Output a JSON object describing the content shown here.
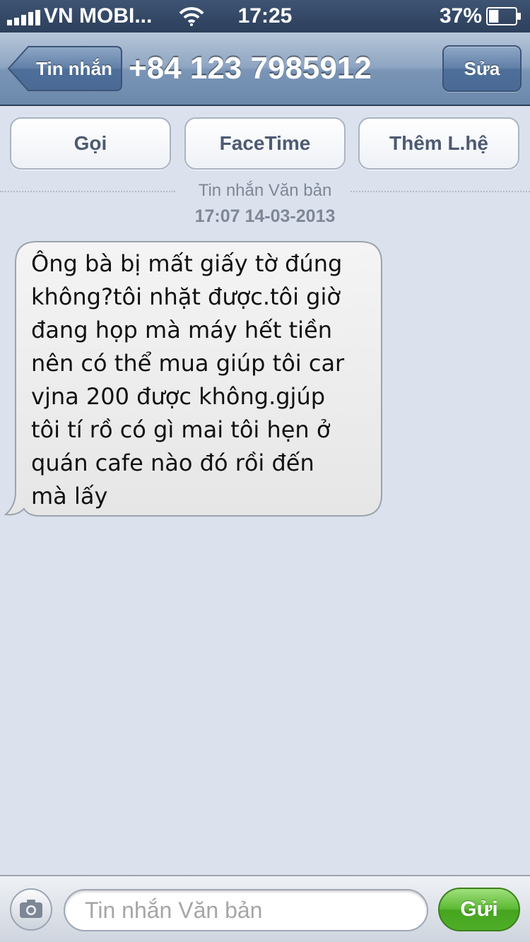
{
  "status_bar": {
    "carrier": "VN MOBI...",
    "time": "17:25",
    "battery_percent": "37%",
    "battery_level": 0.37,
    "icons": [
      "signal-icon",
      "wifi-icon",
      "battery-icon"
    ]
  },
  "nav": {
    "back_label": "Tin nhắn",
    "title": "+84 123 7985912",
    "edit_label": "Sửa"
  },
  "actions": {
    "call_label": "Gọi",
    "facetime_label": "FaceTime",
    "add_contact_label": "Thêm L.hệ"
  },
  "conversation": {
    "type_label": "Tin nhắn Văn bản",
    "timestamp": "17:07 14-03-2013",
    "message": "Ông bà bị mất giấy tờ đúng\nkhông?tôi nhặt được.tôi giờ\nđang họp mà máy hết tiền\nnên có thể mua giúp tôi car\nvjna 200 được không.gjúp\ntôi tí rồ có gì mai tôi hẹn ở\nquán cafe nào đó rồi đến\nmà lấy"
  },
  "composer": {
    "placeholder": "Tin nhắn Văn bản",
    "value": "",
    "send_label": "Gửi",
    "camera_icon": "camera-icon"
  },
  "colors": {
    "background": "#dbe2ed",
    "send_green": "#59b831",
    "nav_blue": "#6b88ab"
  }
}
